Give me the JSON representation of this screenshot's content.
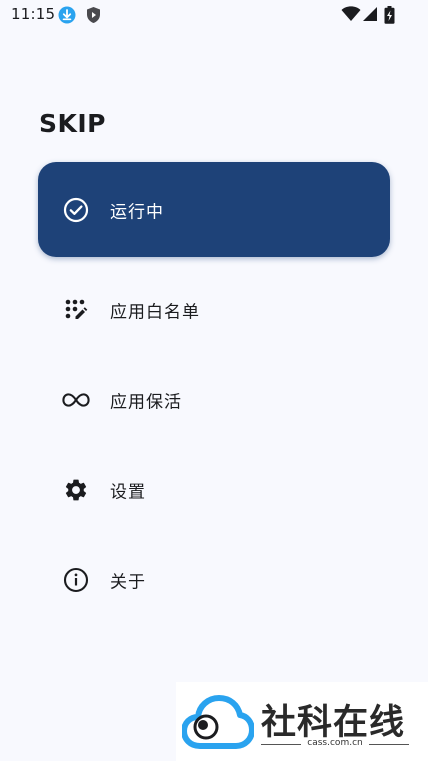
{
  "status_bar": {
    "time": "11:15",
    "icons": [
      "download-icon",
      "shield-icon",
      "wifi-icon",
      "signal-icon",
      "battery-icon"
    ]
  },
  "app": {
    "title": "SKIP"
  },
  "nav": {
    "items": [
      {
        "label": "运行中",
        "icon": "check-circle-icon",
        "active": true
      },
      {
        "label": "应用白名单",
        "icon": "dots-edit-icon",
        "active": false
      },
      {
        "label": "应用保活",
        "icon": "infinity-icon",
        "active": false
      },
      {
        "label": "设置",
        "icon": "gear-icon",
        "active": false
      },
      {
        "label": "关于",
        "icon": "info-icon",
        "active": false
      }
    ]
  },
  "watermark": {
    "title": "社科在线",
    "subtitle": "cass.com.cn"
  },
  "colors": {
    "background": "#f8f9fe",
    "active_item": "#1e4278",
    "text": "#1b1c1f",
    "accent_blue": "#2aa3ef"
  }
}
